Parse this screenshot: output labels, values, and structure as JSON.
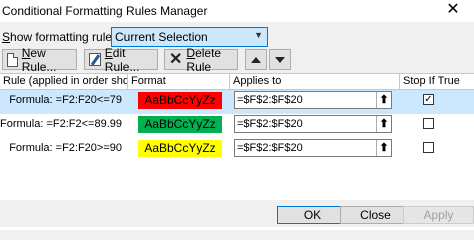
{
  "window": {
    "title": "Conditional Formatting Rules Manager",
    "close_glyph": "✕"
  },
  "show_for": {
    "label_underlined": "S",
    "label_rest": "how formatting rules for:",
    "selected": "Current Selection"
  },
  "toolbar": {
    "new_rule_u": "N",
    "new_rule_rest": "ew Rule...",
    "edit_rule_u": "E",
    "edit_rule_rest": "dit Rule...",
    "delete_rule_u": "D",
    "delete_rule_rest": "elete Rule"
  },
  "columns": {
    "rule": "Rule (applied in order shown)",
    "format": "Format",
    "applies_to": "Applies to",
    "stop_if_true": "Stop If True"
  },
  "rules": [
    {
      "formula": "Formula: =F2:F20<=79",
      "preview": "AaBbCcYyZz",
      "color": "#ff0000",
      "applies_to": "=$F$2:$F$20",
      "stop": true,
      "selected": true
    },
    {
      "formula": "Formula: =F2:F2<=89.99",
      "preview": "AaBbCcYyZz",
      "color": "#00b050",
      "applies_to": "=$F$2:$F$20",
      "stop": false,
      "selected": false
    },
    {
      "formula": "Formula: =F2:F20>=90",
      "preview": "AaBbCcYyZz",
      "color": "#ffff00",
      "applies_to": "=$F$2:$F$20",
      "stop": false,
      "selected": false
    }
  ],
  "dialog_buttons": {
    "ok": "OK",
    "close": "Close",
    "apply": "Apply"
  },
  "colors": {
    "selection": "#cce8ff",
    "accent": "#0078d7"
  }
}
